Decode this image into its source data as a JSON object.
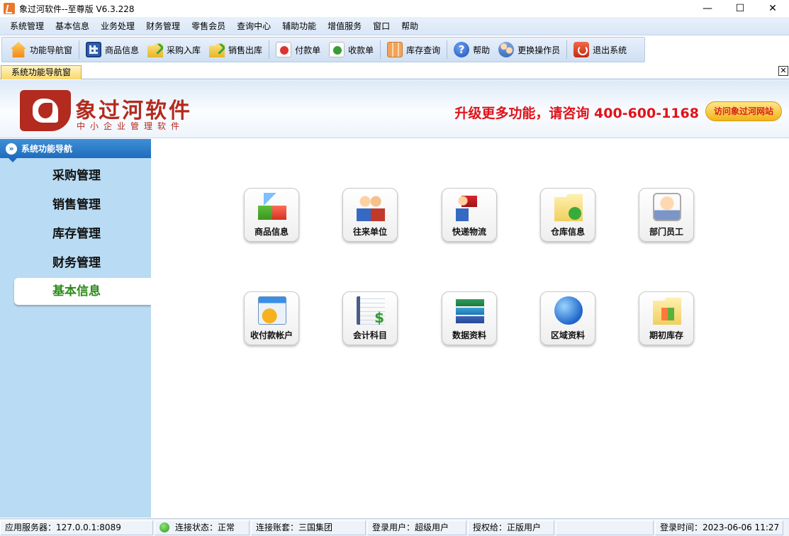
{
  "window": {
    "title": "象过河软件--至尊版 V6.3.228",
    "controls": {
      "minimize": "—",
      "maximize": "☐",
      "close": "✕"
    }
  },
  "menu": [
    "系统管理",
    "基本信息",
    "业务处理",
    "财务管理",
    "零售会员",
    "查询中心",
    "辅助功能",
    "增值服务",
    "窗口",
    "帮助"
  ],
  "toolbar": {
    "nav": "功能导航窗",
    "goods": "商品信息",
    "purchase": "采购入库",
    "sales": "销售出库",
    "payment": "付款单",
    "receipt": "收款单",
    "stock": "库存查询",
    "help": "帮助",
    "switch_user": "更换操作员",
    "exit": "退出系统"
  },
  "tab": {
    "label": "系统功能导航窗",
    "close": "✕"
  },
  "banner": {
    "logo_name": "象过河软件",
    "logo_sub": "中小企业管理软件",
    "promo": "升级更多功能，请咨询 400-600-1168",
    "visit": "访问象过河网站"
  },
  "sidebar": {
    "header": "系统功能导航",
    "header_icon": "»",
    "items": [
      "采购管理",
      "销售管理",
      "库存管理",
      "财务管理",
      "基本信息"
    ],
    "active": "基本信息"
  },
  "tiles": [
    {
      "label": "商品信息",
      "icon": "cubes-icon"
    },
    {
      "label": "往来单位",
      "icon": "partners-icon"
    },
    {
      "label": "快递物流",
      "icon": "logistics-icon"
    },
    {
      "label": "仓库信息",
      "icon": "warehouse-icon"
    },
    {
      "label": "部门员工",
      "icon": "staff-icon"
    },
    {
      "label": "收付款帐户",
      "icon": "account-icon"
    },
    {
      "label": "会计科目",
      "icon": "ledger-icon"
    },
    {
      "label": "数据资料",
      "icon": "books-icon"
    },
    {
      "label": "区域资料",
      "icon": "globe-icon"
    },
    {
      "label": "期初库存",
      "icon": "initial-stock-icon"
    }
  ],
  "status": {
    "server": "应用服务器：127.0.0.1:8089",
    "connection": "连接状态：正常",
    "account_set": "连接账套：三国集团",
    "user": "登录用户：超级用户",
    "license": "授权给：正版用户",
    "empty": "",
    "login_time": "登录时间：2023-06-06 11:27"
  },
  "colors": {
    "accent": "#1f6cbd",
    "brand": "#b32a1e",
    "promo": "#e0121a",
    "active_item": "#2d8a1a"
  }
}
